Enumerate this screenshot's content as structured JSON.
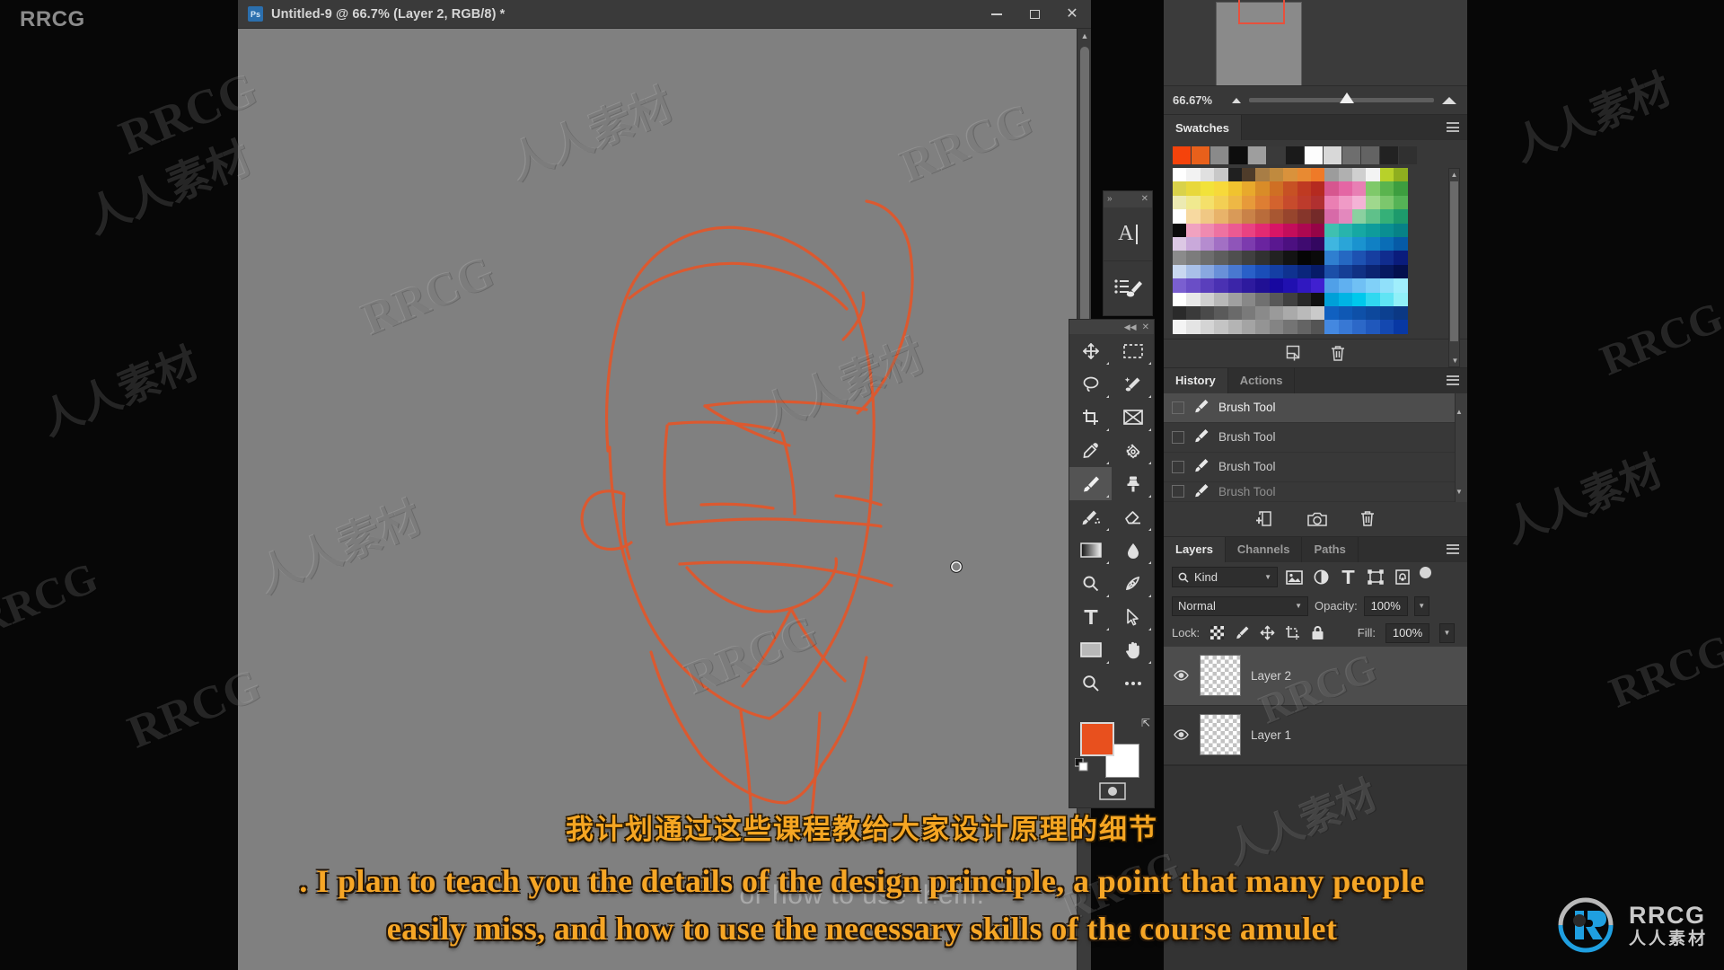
{
  "watermarks": {
    "brand_top_left": "RRCG",
    "texts": [
      "RRCG",
      "人人素材"
    ],
    "bottom_logo": {
      "name": "RRCG",
      "cn": "人人素材",
      "emblem_color": "#1f9fe0"
    }
  },
  "document_window": {
    "title": "Untitled-9 @ 66.7% (Layer 2, RGB/8) *",
    "app_icon_label": "Ps",
    "window_buttons": [
      {
        "name": "minimize",
        "glyph": "—"
      },
      {
        "name": "maximize",
        "glyph": "□"
      },
      {
        "name": "close",
        "glyph": "✕"
      }
    ],
    "canvas_bg": "#808080",
    "sketch_color": "#e2572a"
  },
  "mini_dock": {
    "expand_glyph": "»",
    "close_glyph": "✕",
    "items": [
      {
        "name": "character-panel",
        "glyph": "A"
      },
      {
        "name": "brush-presets-panel",
        "glyph": "brush"
      }
    ]
  },
  "tools_panel": {
    "collapse_glyph": "◀◀",
    "close_glyph": "✕",
    "tools": [
      {
        "name": "move-tool",
        "label": "Move Tool",
        "selected": false,
        "has_flyout": true
      },
      {
        "name": "rectangular-marquee-tool",
        "label": "Rectangular Marquee Tool",
        "selected": false,
        "has_flyout": true
      },
      {
        "name": "lasso-tool",
        "label": "Lasso Tool",
        "selected": false,
        "has_flyout": true
      },
      {
        "name": "quick-selection-tool",
        "label": "Quick Selection Tool",
        "selected": false,
        "has_flyout": true
      },
      {
        "name": "crop-tool",
        "label": "Crop Tool",
        "selected": false,
        "has_flyout": true
      },
      {
        "name": "slice-tool",
        "label": "Slice Tool",
        "selected": false,
        "has_flyout": true
      },
      {
        "name": "eyedropper-tool",
        "label": "Eyedropper Tool",
        "selected": false,
        "has_flyout": true
      },
      {
        "name": "spot-healing-brush-tool",
        "label": "Spot Healing Brush Tool",
        "selected": false,
        "has_flyout": true
      },
      {
        "name": "brush-tool",
        "label": "Brush Tool",
        "selected": true,
        "has_flyout": true
      },
      {
        "name": "clone-stamp-tool",
        "label": "Clone Stamp Tool",
        "selected": false,
        "has_flyout": true
      },
      {
        "name": "history-brush-tool",
        "label": "History Brush Tool",
        "selected": false,
        "has_flyout": true
      },
      {
        "name": "eraser-tool",
        "label": "Eraser Tool",
        "selected": false,
        "has_flyout": true
      },
      {
        "name": "gradient-tool",
        "label": "Gradient Tool",
        "selected": false,
        "has_flyout": true
      },
      {
        "name": "blur-tool",
        "label": "Blur Tool",
        "selected": false,
        "has_flyout": true
      },
      {
        "name": "dodge-tool",
        "label": "Dodge Tool",
        "selected": false,
        "has_flyout": true
      },
      {
        "name": "pen-tool",
        "label": "Pen Tool",
        "selected": false,
        "has_flyout": true
      },
      {
        "name": "horizontal-type-tool",
        "label": "Horizontal Type Tool",
        "selected": false,
        "has_flyout": true
      },
      {
        "name": "path-selection-tool",
        "label": "Path Selection Tool",
        "selected": false,
        "has_flyout": true
      },
      {
        "name": "rectangle-tool",
        "label": "Rectangle Tool",
        "selected": false,
        "has_flyout": true
      },
      {
        "name": "hand-tool",
        "label": "Hand Tool",
        "selected": false,
        "has_flyout": true
      },
      {
        "name": "zoom-tool",
        "label": "Zoom Tool",
        "selected": false,
        "has_flyout": false
      },
      {
        "name": "edit-toolbar",
        "label": "Edit Toolbar",
        "selected": false,
        "has_flyout": false
      }
    ],
    "foreground_color": "#e8501e",
    "background_color": "#ffffff"
  },
  "navigator": {
    "zoom_level": "66.67%",
    "proxy_rect_color": "#e8503c"
  },
  "swatches": {
    "tab_label": "Swatches",
    "recent": [
      "#f5430b",
      "#e8601b",
      "#8a8a8a",
      "#0d0d0d",
      "#9e9e9e",
      "#3a3a3a",
      "#1a1a1a",
      "#fdfdfd",
      "#d8d8d8",
      "#6e6e6e",
      "#636363",
      "#222222",
      "#303030"
    ],
    "new_swatch_label": "Create new swatch",
    "delete_label": "Delete swatch",
    "grid": [
      [
        "#ffffff",
        "#f2f2f2",
        "#e0e0e0",
        "#c8c8c8",
        "#202020",
        "#4f3c2a",
        "#a87d45",
        "#c08a3e",
        "#d9923c",
        "#e88a32",
        "#ef7a28",
        "#9c9c9c",
        "#b0b0b0",
        "#cfcfcf",
        "#f3f3f3",
        "#b8d12a",
        "#8fae1f"
      ],
      [
        "#d9d24a",
        "#e8d83b",
        "#f2e23a",
        "#f7d93a",
        "#f0c32f",
        "#e8a92c",
        "#d98c28",
        "#cf6f24",
        "#c75124",
        "#bf3a22",
        "#b52a20",
        "#d6568f",
        "#e466a4",
        "#e87fb4",
        "#7fc96a",
        "#5ab44e",
        "#3d9e3f"
      ],
      [
        "#eceab2",
        "#f0e98f",
        "#f4e06a",
        "#f3cf54",
        "#eeb845",
        "#e79a3a",
        "#de7e33",
        "#d3632e",
        "#c74b2c",
        "#bd3b2c",
        "#b03030",
        "#ea7fb3",
        "#f09ac6",
        "#f4b3d6",
        "#9fd88d",
        "#7cc76d",
        "#55b356"
      ],
      [
        "#ffffff",
        "#f7d9a0",
        "#f0c884",
        "#e8b36a",
        "#d99a58",
        "#c98248",
        "#b96c3b",
        "#a85732",
        "#97452d",
        "#86362b",
        "#742a29",
        "#d76aa8",
        "#e388bd",
        "#8ad0a0",
        "#5fc18a",
        "#35b078",
        "#1d9a6c"
      ],
      [
        "#0a0a0a",
        "#f0a2c0",
        "#ef8ab0",
        "#ee72a1",
        "#ec5a92",
        "#e94282",
        "#e32a72",
        "#d81566",
        "#c40d5b",
        "#ad0851",
        "#960447",
        "#3fc0b0",
        "#28b4ad",
        "#16a8a3",
        "#0e9c9b",
        "#0a8f92",
        "#078287"
      ],
      [
        "#dcc8e4",
        "#c9a9da",
        "#b58ccf",
        "#a270c4",
        "#8f55b9",
        "#7c3bae",
        "#6a249f",
        "#5a1890",
        "#4c1080",
        "#3f0b70",
        "#330760",
        "#3fb6e0",
        "#2aa5d8",
        "#1a93cf",
        "#1080c4",
        "#0a6db6",
        "#065aa6"
      ],
      [
        "#8b8b8b",
        "#7c7c7c",
        "#6d6d6d",
        "#5e5e5e",
        "#4f4f4f",
        "#404040",
        "#313131",
        "#222222",
        "#131313",
        "#050505",
        "#0a0a0a",
        "#2f7fd0",
        "#2568c2",
        "#1d52b2",
        "#163ea0",
        "#102c8e",
        "#0a1c7c"
      ],
      [
        "#c9d8f0",
        "#a9c0e8",
        "#89a8e0",
        "#6990d8",
        "#4978d0",
        "#2960c8",
        "#1a4eb8",
        "#143fa4",
        "#0f3290",
        "#0a267c",
        "#061b68",
        "#1b4fa8",
        "#153f96",
        "#103184",
        "#0b2472",
        "#071960",
        "#04104e"
      ],
      [
        "#7a5fd0",
        "#6a4ec6",
        "#5a3fbc",
        "#4a31b2",
        "#3b25a8",
        "#2d1a9e",
        "#201094",
        "#1708a0",
        "#2010b0",
        "#3018c0",
        "#4020d0",
        "#50a0e8",
        "#60b0f0",
        "#70c0f4",
        "#80d0f8",
        "#90e0fa",
        "#a0eefc"
      ],
      [
        "#ffffff",
        "#e8e8e8",
        "#d0d0d0",
        "#b8b8b8",
        "#a0a0a0",
        "#888888",
        "#707070",
        "#585858",
        "#404040",
        "#282828",
        "#101010",
        "#00a0d8",
        "#00b4e4",
        "#00c8ec",
        "#30d8f0",
        "#60e4f4",
        "#90f0f8"
      ],
      [
        "#2a2a2a",
        "#3a3a3a",
        "#4a4a4a",
        "#5a5a5a",
        "#6a6a6a",
        "#7a7a7a",
        "#8a8a8a",
        "#9a9a9a",
        "#aaaaaa",
        "#bababa",
        "#cacaca",
        "#1060c0",
        "#0f58b4",
        "#0e50a8",
        "#0d489c",
        "#0c4090",
        "#0b3884"
      ],
      [
        "#f4f4f4",
        "#e4e4e4",
        "#d4d4d4",
        "#c4c4c4",
        "#b4b4b4",
        "#a4a4a4",
        "#949494",
        "#848484",
        "#747474",
        "#646464",
        "#545454",
        "#4488e0",
        "#3878d4",
        "#2c68c8",
        "#2058bc",
        "#1448b0",
        "#0838a4"
      ]
    ]
  },
  "history": {
    "tabs": [
      {
        "label": "History",
        "active": true
      },
      {
        "label": "Actions",
        "active": false
      }
    ],
    "entries": [
      {
        "label": "Brush Tool",
        "active": false,
        "clipped": true
      },
      {
        "label": "Brush Tool",
        "active": false,
        "clipped": false
      },
      {
        "label": "Brush Tool",
        "active": false,
        "clipped": false
      },
      {
        "label": "Brush Tool",
        "active": true,
        "clipped": false
      }
    ],
    "footer_buttons": [
      {
        "name": "new-document-from-state",
        "label": "Create new document from current state"
      },
      {
        "name": "new-snapshot",
        "label": "Create new snapshot"
      },
      {
        "name": "delete-state",
        "label": "Delete current state"
      }
    ]
  },
  "layers": {
    "tabs": [
      {
        "label": "Layers",
        "active": true
      },
      {
        "label": "Channels",
        "active": false
      },
      {
        "label": "Paths",
        "active": false
      }
    ],
    "filter_kind": "Kind",
    "filter_icons": [
      {
        "name": "filter-pixel-layers"
      },
      {
        "name": "filter-adjustment-layers"
      },
      {
        "name": "filter-type-layers"
      },
      {
        "name": "filter-shape-layers"
      },
      {
        "name": "filter-smart-objects"
      }
    ],
    "blend_mode": "Normal",
    "opacity_label": "Opacity:",
    "opacity_value": "100%",
    "lock_label": "Lock:",
    "lock_icons": [
      {
        "name": "lock-transparent-pixels"
      },
      {
        "name": "lock-image-pixels"
      },
      {
        "name": "lock-position"
      },
      {
        "name": "lock-artboard-nesting"
      },
      {
        "name": "lock-all"
      }
    ],
    "fill_label": "Fill:",
    "fill_value": "100%",
    "items": [
      {
        "name": "Layer 2",
        "active": true
      },
      {
        "name": "Layer 1",
        "active": false
      }
    ]
  },
  "subtitles": {
    "chinese": "我计划通过这些课程教给大家设计原理的细节",
    "english_line1": ". I plan to teach you the details of the design principle, a point that many people",
    "english_line2": "easily miss, and how to use the necessary skills of the course amulet",
    "ghost_line": "or how to use them."
  }
}
